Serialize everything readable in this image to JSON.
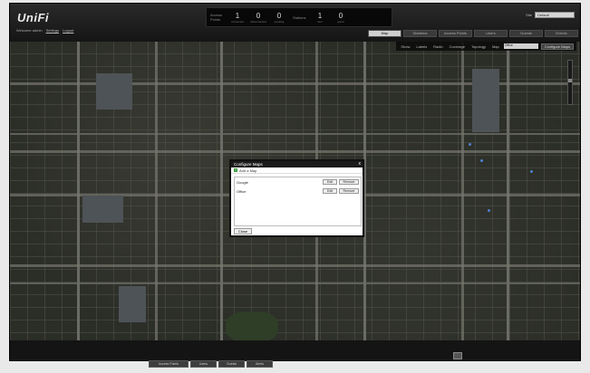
{
  "app": {
    "logo": "UniFi",
    "sublinks": [
      "Welcome admin",
      "Settings",
      "Logout"
    ]
  },
  "stats": {
    "access_points_label": "Access Points",
    "access_points": [
      {
        "value": "1",
        "caption": "connected"
      },
      {
        "value": "0",
        "caption": "disconnected"
      },
      {
        "value": "0",
        "caption": "pending"
      }
    ],
    "stations_label": "Stations",
    "stations": [
      {
        "value": "1",
        "caption": "user"
      },
      {
        "value": "0",
        "caption": "guest"
      }
    ]
  },
  "site": {
    "label": "Site",
    "value": "Default"
  },
  "tabs": [
    {
      "label": "Map",
      "active": true
    },
    {
      "label": "Statistics",
      "active": false
    },
    {
      "label": "Access Points",
      "active": false
    },
    {
      "label": "Users",
      "active": false
    },
    {
      "label": "Guests",
      "active": false
    },
    {
      "label": "Events",
      "active": false
    }
  ],
  "mapbar": {
    "items": [
      "Show",
      "Labels",
      "Radio",
      "Coverage",
      "Topology"
    ],
    "map_label": "Map",
    "map_value": "Office",
    "configure": "Configure Maps"
  },
  "dialog": {
    "title": "Configure Maps",
    "close": "x",
    "add_label": "Add a Map",
    "rows": [
      {
        "name": "Google",
        "edit": "Edit",
        "remove": "Remove"
      },
      {
        "name": "Office",
        "edit": "Edit",
        "remove": "Remove"
      }
    ],
    "close_button": "Close"
  },
  "bottom_tabs": [
    "Access Points",
    "Users",
    "Guests",
    "Alerts"
  ],
  "colors": {
    "accent": "#3c9a3c",
    "ap_dot": "#4d7fd0"
  }
}
